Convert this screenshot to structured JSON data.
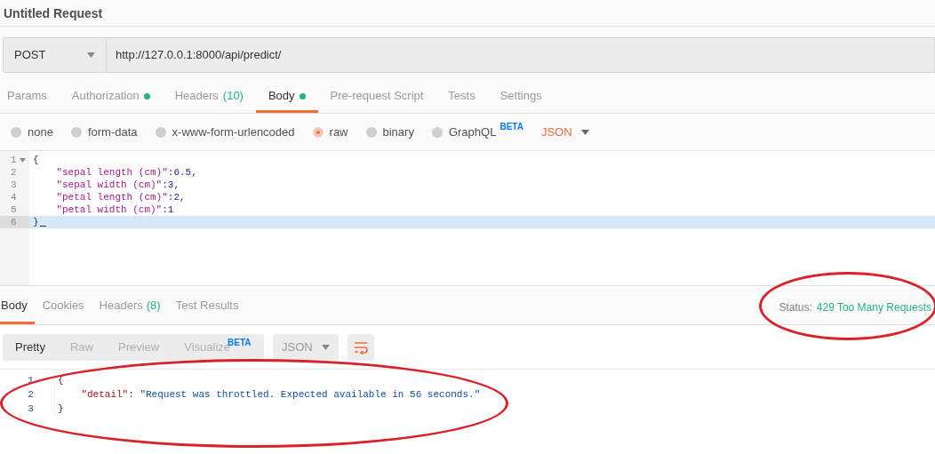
{
  "request": {
    "title": "Untitled Request",
    "method": "POST",
    "url": "http://127.0.0.1:8000/api/predict/"
  },
  "request_tabs": [
    {
      "label": "Params",
      "selected": false
    },
    {
      "label": "Authorization",
      "dot": true,
      "selected": false
    },
    {
      "label": "Headers",
      "count": "(10)",
      "selected": false
    },
    {
      "label": "Body",
      "dot": true,
      "selected": true
    },
    {
      "label": "Pre-request Script",
      "selected": false
    },
    {
      "label": "Tests",
      "selected": false
    },
    {
      "label": "Settings",
      "selected": false
    }
  ],
  "body_types": [
    {
      "label": "none",
      "selected": false
    },
    {
      "label": "form-data",
      "selected": false
    },
    {
      "label": "x-www-form-urlencoded",
      "selected": false
    },
    {
      "label": "raw",
      "selected": true
    },
    {
      "label": "binary",
      "selected": false
    },
    {
      "label": "GraphQL",
      "badge": "BETA",
      "selected": false
    }
  ],
  "body_format": "JSON",
  "request_body": [
    {
      "number": "1",
      "foldable": true,
      "current": false,
      "tokens": [
        {
          "kind": "punct",
          "text": "{"
        }
      ]
    },
    {
      "number": "2",
      "current": false,
      "indented": true,
      "tokens": [
        {
          "kind": "key",
          "text": "\"sepal length (cm)\""
        },
        {
          "kind": "punct",
          "text": ":"
        },
        {
          "kind": "number",
          "text": "6.5"
        },
        {
          "kind": "punct",
          "text": ","
        }
      ]
    },
    {
      "number": "3",
      "current": false,
      "indented": true,
      "tokens": [
        {
          "kind": "key",
          "text": "\"sepal width (cm)\""
        },
        {
          "kind": "punct",
          "text": ":"
        },
        {
          "kind": "number",
          "text": "3"
        },
        {
          "kind": "punct",
          "text": ","
        }
      ]
    },
    {
      "number": "4",
      "current": false,
      "indented": true,
      "tokens": [
        {
          "kind": "key",
          "text": "\"petal length (cm)\""
        },
        {
          "kind": "punct",
          "text": ":"
        },
        {
          "kind": "number",
          "text": "2"
        },
        {
          "kind": "punct",
          "text": ","
        }
      ]
    },
    {
      "number": "5",
      "current": false,
      "indented": true,
      "tokens": [
        {
          "kind": "key",
          "text": "\"petal width (cm)\""
        },
        {
          "kind": "punct",
          "text": ":"
        },
        {
          "kind": "number",
          "text": "1"
        }
      ]
    },
    {
      "number": "6",
      "current": true,
      "tokens": [
        {
          "kind": "punct",
          "text": "}"
        }
      ]
    }
  ],
  "response_tabs": [
    {
      "label": "Body",
      "selected": true
    },
    {
      "label": "Cookies",
      "selected": false
    },
    {
      "label": "Headers",
      "count": "(8)",
      "selected": false
    },
    {
      "label": "Test Results",
      "selected": false
    }
  ],
  "status": {
    "label": "Status:",
    "value": "429 Too Many Requests",
    "highlight": true
  },
  "view_modes": [
    {
      "label": "Pretty",
      "selected": true
    },
    {
      "label": "Raw",
      "selected": false
    },
    {
      "label": "Preview",
      "selected": false
    },
    {
      "label": "Visualize",
      "badge": "BETA",
      "selected": false
    }
  ],
  "response_format": "JSON",
  "response_body": {
    "highlight": true,
    "lines": [
      {
        "number": "1",
        "tokens": [
          {
            "kind": "punct",
            "text": "{"
          }
        ]
      },
      {
        "number": "2",
        "indented": true,
        "tokens": [
          {
            "kind": "key",
            "text": "\"detail\""
          },
          {
            "kind": "punct",
            "text": ": "
          },
          {
            "kind": "string",
            "text": "\"Request was throttled. Expected available in 56 seconds.\""
          }
        ]
      },
      {
        "number": "3",
        "tokens": [
          {
            "kind": "punct",
            "text": "}"
          }
        ]
      }
    ]
  }
}
